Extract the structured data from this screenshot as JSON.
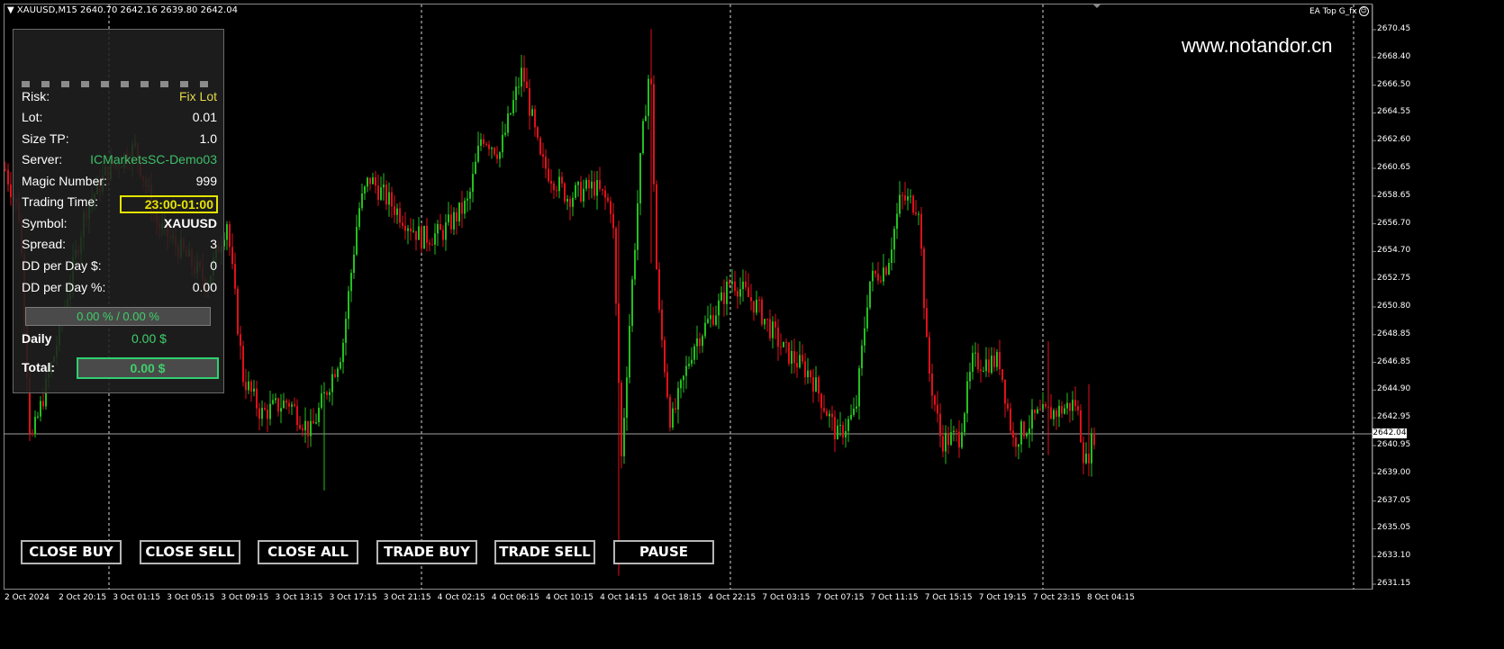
{
  "header": {
    "symbol": "XAUUSD,M15",
    "ohlc": "2640.70 2642.16 2639.80 2642.04"
  },
  "ea_label": "EA Top G_fx",
  "watermark": "www.notandor.cn",
  "price_axis": {
    "ticks": [
      "2670.45",
      "2668.40",
      "2666.50",
      "2664.55",
      "2662.60",
      "2660.65",
      "2658.65",
      "2656.70",
      "2654.70",
      "2652.75",
      "2650.80",
      "2648.85",
      "2646.85",
      "2644.90",
      "2642.95",
      "2640.95",
      "2639.00",
      "2637.05",
      "2635.05",
      "2633.10",
      "2631.15"
    ],
    "current_price": "2642.04"
  },
  "time_axis": {
    "ticks": [
      "2 Oct 2024",
      "2 Oct 20:15",
      "3 Oct 01:15",
      "3 Oct 05:15",
      "3 Oct 09:15",
      "3 Oct 13:15",
      "3 Oct 17:15",
      "3 Oct 21:15",
      "4 Oct 02:15",
      "4 Oct 06:15",
      "4 Oct 10:15",
      "4 Oct 14:15",
      "4 Oct 18:15",
      "4 Oct 22:15",
      "7 Oct 03:15",
      "7 Oct 07:15",
      "7 Oct 11:15",
      "7 Oct 15:15",
      "7 Oct 19:15",
      "7 Oct 23:15",
      "8 Oct 04:15"
    ]
  },
  "panel": {
    "rows": [
      {
        "label": "Risk:",
        "value": "Fix Lot",
        "color": "#e4d84a"
      },
      {
        "label": "Lot:",
        "value": "0.01",
        "color": "#ffffff"
      },
      {
        "label": "Size TP:",
        "value": "1.0",
        "color": "#ffffff"
      },
      {
        "label": "Server:",
        "value": "ICMarketsSC-Demo03",
        "color": "#3fbf6a"
      },
      {
        "label": "Magic Number:",
        "value": "999",
        "color": "#ffffff"
      },
      {
        "label": "Trading Time:",
        "value": "",
        "color": "#ffffff"
      },
      {
        "label": "Symbol:",
        "value": "XAUUSD",
        "color": "#ffffff"
      },
      {
        "label": "Spread:",
        "value": "3",
        "color": "#ffffff"
      },
      {
        "label": "DD per Day $:",
        "value": "0",
        "color": "#ffffff"
      },
      {
        "label": "DD per Day %:",
        "value": "0.00",
        "color": "#ffffff"
      }
    ],
    "trading_time": "23:00-01:00",
    "dd_progress": "0.00 % / 0.00 %",
    "daily_label": "Daily",
    "daily_value": "0.00 $",
    "total_label": "Total:",
    "total_value": "0.00 $"
  },
  "buttons": {
    "close_buy": "CLOSE BUY",
    "close_sell": "CLOSE SELL",
    "close_all": "CLOSE ALL",
    "trade_buy": "TRADE BUY",
    "trade_sell": "TRADE SELL",
    "pause": "PAUSE"
  },
  "colors": {
    "bull": "#23c01f",
    "bear": "#e0101a",
    "background": "#000000",
    "price_line": "#a0a0a0"
  }
}
